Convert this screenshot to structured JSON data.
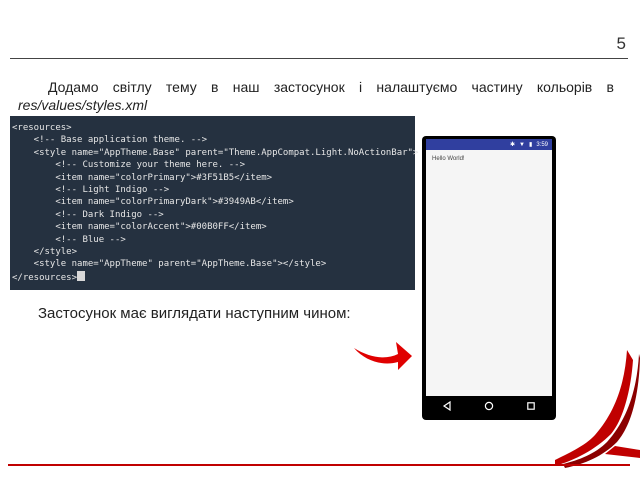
{
  "page": {
    "number": "5"
  },
  "intro": {
    "text_before": "Додамо світлу тему в наш застосунок і налаштуємо частину кольорів в ",
    "path": "res/values/styles.xml"
  },
  "code": {
    "lines": [
      {
        "text": "<resources>",
        "cursor": false
      },
      {
        "text": "    <!-- Base application theme. -->",
        "cursor": false
      },
      {
        "text": "    <style name=\"AppTheme.Base\" parent=\"Theme.AppCompat.Light.NoActionBar\">",
        "cursor": false
      },
      {
        "text": "        <!-- Customize your theme here. -->",
        "cursor": false
      },
      {
        "text": "        <item name=\"colorPrimary\">#3F51B5</item>",
        "cursor": false
      },
      {
        "text": "        <!-- Light Indigo -->",
        "cursor": false
      },
      {
        "text": "        <item name=\"colorPrimaryDark\">#3949AB</item>",
        "cursor": false
      },
      {
        "text": "        <!-- Dark Indigo -->",
        "cursor": false
      },
      {
        "text": "        <item name=\"colorAccent\">#00B0FF</item>",
        "cursor": false
      },
      {
        "text": "        <!-- Blue -->",
        "cursor": false
      },
      {
        "text": "    </style>",
        "cursor": false
      },
      {
        "text": "    <style name=\"AppTheme\" parent=\"AppTheme.Base\"></style>",
        "cursor": false
      },
      {
        "text": "</resources>",
        "cursor": true
      }
    ]
  },
  "caption": "Застосунок має виглядати наступним чином:",
  "phone": {
    "status_time": "3:59",
    "hello_text": "Hello World!"
  },
  "colors": {
    "code_bg": "#253140",
    "status_bar": "#303f9f",
    "accent_red": "#e00000"
  },
  "icons": [
    "red-arrow-icon",
    "bluetooth-icon",
    "signal-icon",
    "battery-icon",
    "back-icon",
    "home-icon",
    "recents-icon",
    "book-corner-decoration"
  ]
}
